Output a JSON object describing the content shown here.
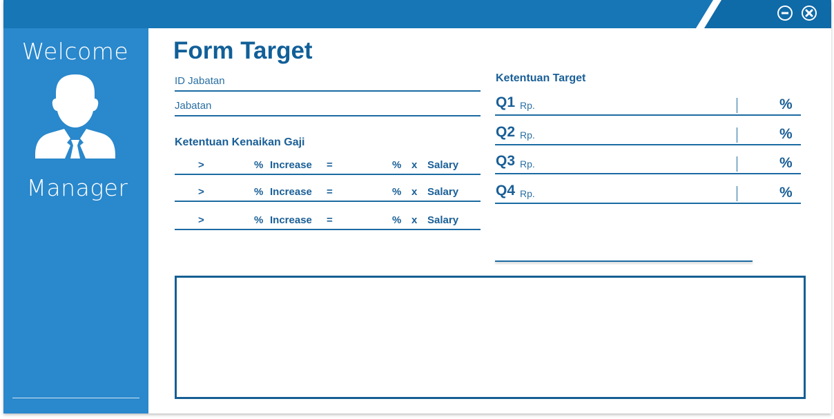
{
  "window": {
    "minimize_icon": "minus-circle-icon",
    "close_icon": "x-circle-icon",
    "colors": {
      "titlebar": "#1676b6",
      "sidebar": "#2a88cc",
      "accent": "#115f98"
    }
  },
  "sidebar": {
    "welcome": "Welcome",
    "avatar_icon": "user-avatar-icon",
    "role": "Manager"
  },
  "form": {
    "title": "Form Target",
    "fields": [
      {
        "label": "ID Jabatan"
      },
      {
        "label": "Jabatan"
      }
    ],
    "salary_rules": {
      "title": "Ketentuan Kenaikan Gaji",
      "rows": [
        {
          "gt": ">",
          "pct": "%",
          "increase": "Increase",
          "eq": "=",
          "pct2": "%",
          "times": "x",
          "salary": "Salary"
        },
        {
          "gt": ">",
          "pct": "%",
          "increase": "Increase",
          "eq": "=",
          "pct2": "%",
          "times": "x",
          "salary": "Salary"
        },
        {
          "gt": ">",
          "pct": "%",
          "increase": "Increase",
          "eq": "=",
          "pct2": "%",
          "times": "x",
          "salary": "Salary"
        }
      ]
    },
    "targets": {
      "title": "Ketentuan Target",
      "rows": [
        {
          "quarter": "Q1",
          "currency": "Rp.",
          "pct": "%"
        },
        {
          "quarter": "Q2",
          "currency": "Rp.",
          "pct": "%"
        },
        {
          "quarter": "Q3",
          "currency": "Rp.",
          "pct": "%"
        },
        {
          "quarter": "Q4",
          "currency": "Rp.",
          "pct": "%"
        }
      ]
    }
  }
}
